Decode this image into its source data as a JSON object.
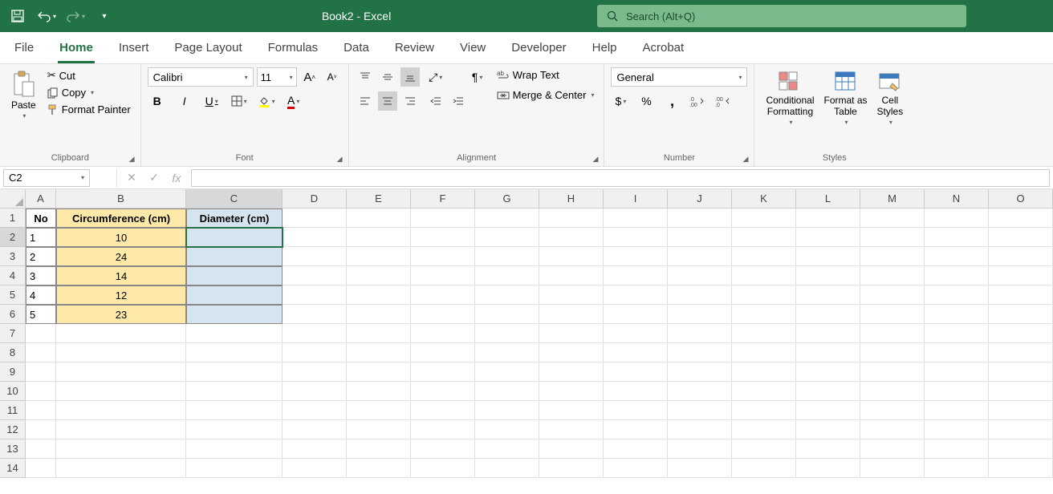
{
  "title": "Book2  -  Excel",
  "search": {
    "placeholder": "Search (Alt+Q)"
  },
  "tabs": [
    "File",
    "Home",
    "Insert",
    "Page Layout",
    "Formulas",
    "Data",
    "Review",
    "View",
    "Developer",
    "Help",
    "Acrobat"
  ],
  "activeTab": "Home",
  "clipboard": {
    "paste": "Paste",
    "cut": "Cut",
    "copy": "Copy",
    "formatPainter": "Format Painter",
    "label": "Clipboard"
  },
  "font": {
    "name": "Calibri",
    "size": "11",
    "label": "Font"
  },
  "alignment": {
    "wrap": "Wrap Text",
    "merge": "Merge & Center",
    "label": "Alignment"
  },
  "number": {
    "format": "General",
    "label": "Number"
  },
  "styles": {
    "cond": "Conditional\nFormatting",
    "table": "Format as\nTable",
    "cell": "Cell\nStyles",
    "label": "Styles"
  },
  "nameBox": "C2",
  "formula": "",
  "colWidths": {
    "A": 38,
    "B": 162,
    "C": 120,
    "other": 80
  },
  "columns": [
    "A",
    "B",
    "C",
    "D",
    "E",
    "F",
    "G",
    "H",
    "I",
    "J",
    "K",
    "L",
    "M",
    "N",
    "O"
  ],
  "rowCount": 14,
  "activeCell": {
    "row": 2,
    "col": "C"
  },
  "sheet": {
    "headers": {
      "A": "No",
      "B": "Circumference (cm)",
      "C": "Diameter (cm)"
    },
    "rows": [
      {
        "no": "1",
        "circ": "10",
        "diam": ""
      },
      {
        "no": "2",
        "circ": "24",
        "diam": ""
      },
      {
        "no": "3",
        "circ": "14",
        "diam": ""
      },
      {
        "no": "4",
        "circ": "12",
        "diam": ""
      },
      {
        "no": "5",
        "circ": "23",
        "diam": ""
      }
    ]
  }
}
